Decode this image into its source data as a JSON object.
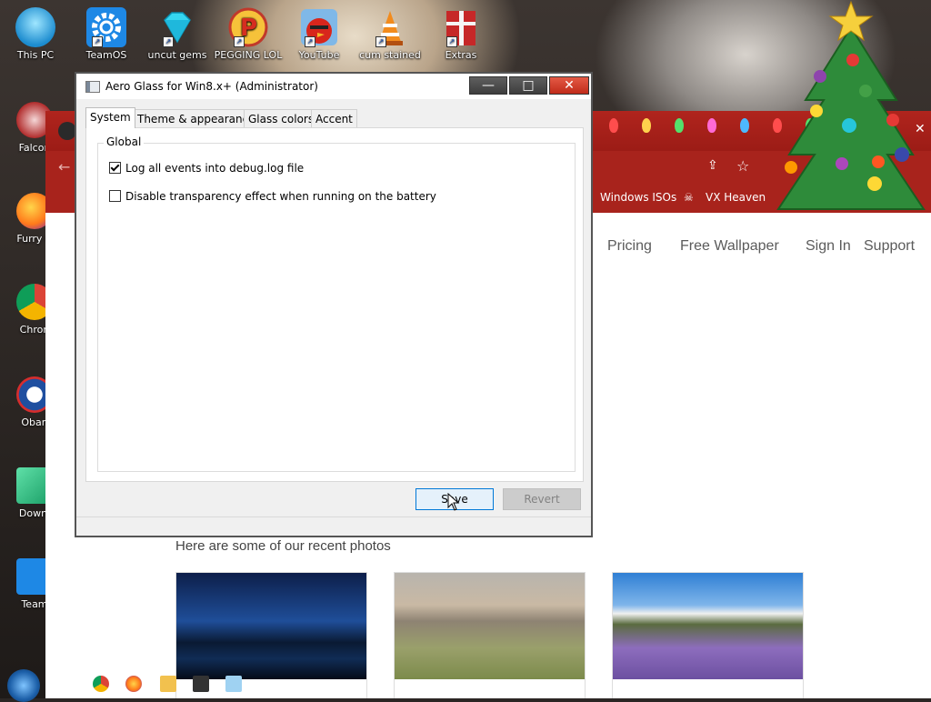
{
  "desktop": {
    "top_icons": [
      {
        "label": "This PC"
      },
      {
        "label": "TeamOS"
      },
      {
        "label": "uncut gems"
      },
      {
        "label": "PEGGING LOL"
      },
      {
        "label": "YouTube"
      },
      {
        "label": "cum stained"
      },
      {
        "label": "Extras"
      }
    ],
    "left_icons": [
      {
        "label": "Falcon"
      },
      {
        "label": "Furry C"
      },
      {
        "label": "Chron"
      },
      {
        "label": "Oban"
      },
      {
        "label": "Downl"
      },
      {
        "label": "Team"
      }
    ]
  },
  "browser": {
    "bookmarks": [
      "Windows ISOs",
      "VX Heaven"
    ],
    "nav": [
      "Pricing",
      "Free Wallpaper",
      "Sign In",
      "Support"
    ],
    "recent_heading": "Here are some of our recent photos"
  },
  "dialog": {
    "title": "Aero Glass for Win8.x+ (Administrator)",
    "tabs": [
      "System",
      "Theme & appearance",
      "Glass colors",
      "Accent"
    ],
    "active_tab": "System",
    "group_label": "Global",
    "options": [
      {
        "label": "Log all events into debug.log file",
        "checked": true
      },
      {
        "label": "Disable transparency effect when running on the battery",
        "checked": false
      }
    ],
    "buttons": {
      "save": "Save",
      "revert": "Revert"
    },
    "caption": {
      "minimize": "—",
      "maximize": "□",
      "close": "✕"
    }
  }
}
